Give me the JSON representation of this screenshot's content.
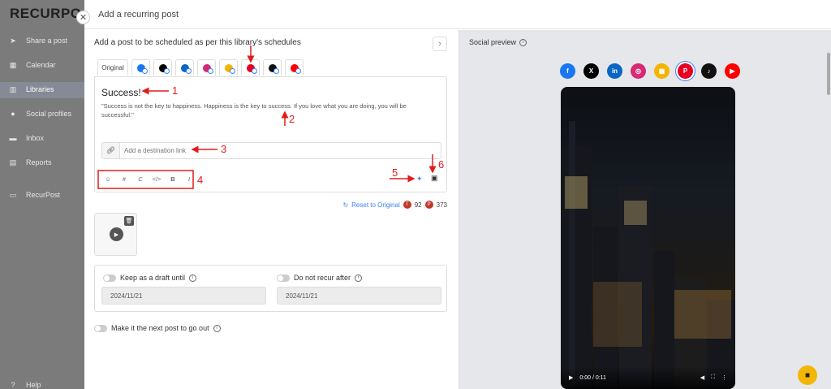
{
  "sidebar": {
    "logo": "RECURPO",
    "items": [
      {
        "label": "Share a post",
        "icon": "send-icon"
      },
      {
        "label": "Calendar",
        "icon": "calendar-icon"
      },
      {
        "label": "Libraries",
        "icon": "library-icon"
      },
      {
        "label": "Social profiles",
        "icon": "profile-icon"
      },
      {
        "label": "Inbox",
        "icon": "inbox-icon"
      },
      {
        "label": "Reports",
        "icon": "reports-icon"
      },
      {
        "label": "RecurPost",
        "icon": "monitor-icon"
      },
      {
        "label": "Help",
        "icon": "help-icon"
      }
    ]
  },
  "header": {
    "title": "Add a recurring post"
  },
  "main": {
    "subtitle": "Add a post to be scheduled as per this library's schedules",
    "tabs": {
      "original": "Original",
      "icons": [
        "facebook",
        "x",
        "linkedin",
        "instagram",
        "google-business",
        "pinterest",
        "tiktok",
        "youtube"
      ]
    },
    "post": {
      "title": "Success!",
      "body": "\"Success is not the key to happiness. Happiness is the key to success. If you love what you are doing, you will be successful.\""
    },
    "link": {
      "placeholder": "Add a destination link"
    },
    "toolbar": [
      "☺",
      "#",
      "C",
      "</>",
      "B",
      "I"
    ],
    "reset_label": "Reset to Original",
    "counts": [
      {
        "badge": "T",
        "value": "92"
      },
      {
        "badge": "P",
        "value": "373"
      }
    ],
    "media_caption": "",
    "draft_label": "Keep as a draft until",
    "draft_date": "2024/11/21",
    "recur_label": "Do not recur after",
    "recur_date": "2024/11/21",
    "next_post_label": "Make it the next post to go out"
  },
  "preview": {
    "title": "Social preview",
    "networks": [
      {
        "name": "facebook",
        "letter": "f",
        "color": "#1877f2"
      },
      {
        "name": "x",
        "letter": "X",
        "color": "#000000"
      },
      {
        "name": "linkedin",
        "letter": "in",
        "color": "#0a66c2"
      },
      {
        "name": "instagram",
        "letter": "◎",
        "color": "#d62976"
      },
      {
        "name": "google-business",
        "letter": "▦",
        "color": "#f4b400"
      },
      {
        "name": "pinterest",
        "letter": "P",
        "color": "#e60023"
      },
      {
        "name": "tiktok",
        "letter": "♪",
        "color": "#111111"
      },
      {
        "name": "youtube",
        "letter": "▶",
        "color": "#ff0000"
      }
    ],
    "video_time": "0:00 / 0:11"
  },
  "annotations": [
    "1",
    "2",
    "3",
    "4",
    "5",
    "6"
  ],
  "colors": {
    "accent": "#3b82f6",
    "annotation": "#e21b1b",
    "chat": "#f2b705"
  }
}
